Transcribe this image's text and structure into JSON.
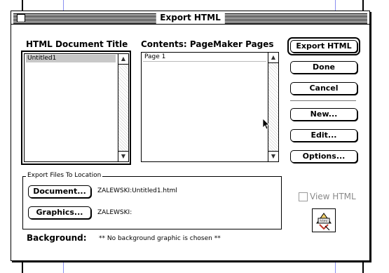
{
  "window": {
    "title": "Export HTML"
  },
  "html_document_title": {
    "label": "HTML Document Title",
    "items": [
      "Untitled1"
    ],
    "selected": "Untitled1"
  },
  "contents": {
    "label": "Contents: PageMaker Pages",
    "items": [
      "Page 1"
    ]
  },
  "buttons": {
    "export_html": "Export HTML",
    "done": "Done",
    "cancel": "Cancel",
    "new": "New...",
    "edit": "Edit...",
    "options": "Options..."
  },
  "export_location": {
    "group_label": "Export Files To Location",
    "document_button": "Document...",
    "document_path": "ZALEWSKI:Untitled1.html",
    "graphics_button": "Graphics...",
    "graphics_path": "ZALEWSKI:"
  },
  "view_html": {
    "label": "View HTML",
    "checked": false,
    "enabled": false
  },
  "background": {
    "label": "Background:",
    "value": "** No background graphic is chosen **"
  },
  "icons": {
    "html_icon": "html-document-icon"
  },
  "colors": {
    "guide_blue": "#8a8ff0",
    "disabled_gray": "#8a8a8a"
  }
}
